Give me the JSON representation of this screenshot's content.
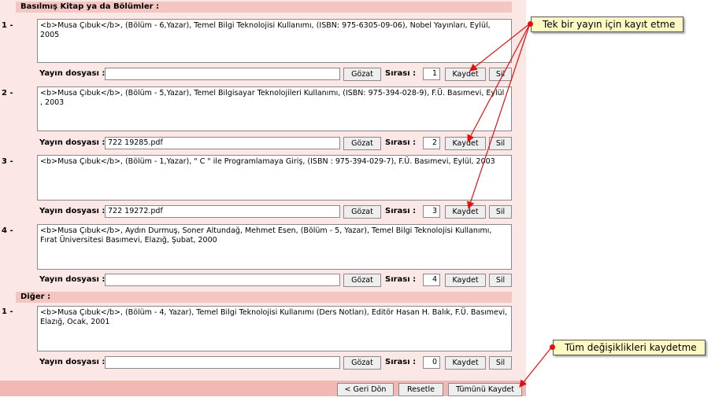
{
  "section_printed": "Basılmış Kitap ya da Bölümler :",
  "section_other": "Diğer :",
  "labels": {
    "file": "Yayın dosyası :",
    "order": "Sırası :",
    "browse": "Gözat",
    "save": "Kaydet",
    "delete": "Sil"
  },
  "entries": [
    {
      "num": "1 -",
      "text": "<b>Musa Çıbuk</b>, (Bölüm - 6,Yazar), Temel Bilgi Teknolojisi Kullanımı, (ISBN: 975-6305-09-06), Nobel Yayınları, Eylül, 2005",
      "file": "",
      "order": "1"
    },
    {
      "num": "2 -",
      "text": "<b>Musa Çıbuk</b>, (Bölüm - 5,Yazar), Temel Bilgisayar Teknolojileri Kullanımı,  (ISBN: 975-394-028-9), F.Ü. Basımevi, Eylül , 2003",
      "file": "722  19285.pdf",
      "order": "2"
    },
    {
      "num": "3 -",
      "text": "<b>Musa Çıbuk</b>, (Bölüm - 1,Yazar), \" C \" ile Programlamaya Giriş,  (ISBN : 975-394-029-7), F.Ü. Basımevi, Eylül, 2003",
      "file": "722  19272.pdf",
      "order": "3"
    },
    {
      "num": "4 -",
      "text": "<b>Musa Çıbuk</b>, Aydın Durmuş, Soner Altundağ, Mehmet Esen, (Bölüm - 5, Yazar), Temel Bilgi Teknolojisi Kullanımı, Fırat Üniversitesi Basımevi, Elazığ, Şubat, 2000",
      "file": "",
      "order": "4"
    },
    {
      "num": "1 -",
      "text": "<b>Musa Çıbuk</b>, (Bölüm - 4, Yazar), Temel Bilgi Teknolojisi Kullanımı (Ders Notları),  Editör Hasan H. Balık, F.Ü. Basımevi, Elazığ, Ocak, 2001",
      "file": "",
      "order": "0"
    }
  ],
  "footer": {
    "back": "< Geri Dön",
    "reset": "Resetle",
    "save_all": "Tümünü Kaydet"
  },
  "callouts": {
    "single": "Tek bir yayın için kayıt etme",
    "all": "Tüm değişiklikleri kaydetme"
  },
  "colors": {
    "band": "#fbe8e6",
    "header": "#f4c6c2",
    "callout": "#fff9c4",
    "arrow": "#e11010"
  }
}
